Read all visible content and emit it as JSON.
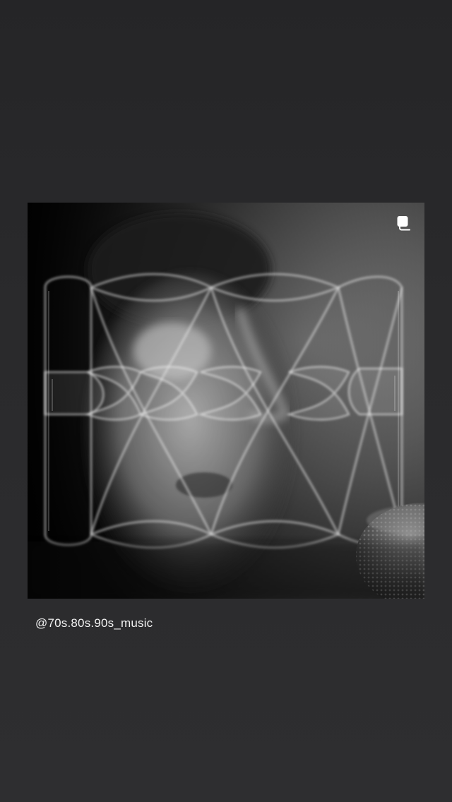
{
  "story": {
    "background_color": "#2b2b2d",
    "shared_post": {
      "media_type": "multiple-images",
      "indicator_icon": "carousel-stack-icon",
      "author_handle": "@70s.80s.90s_music"
    }
  }
}
